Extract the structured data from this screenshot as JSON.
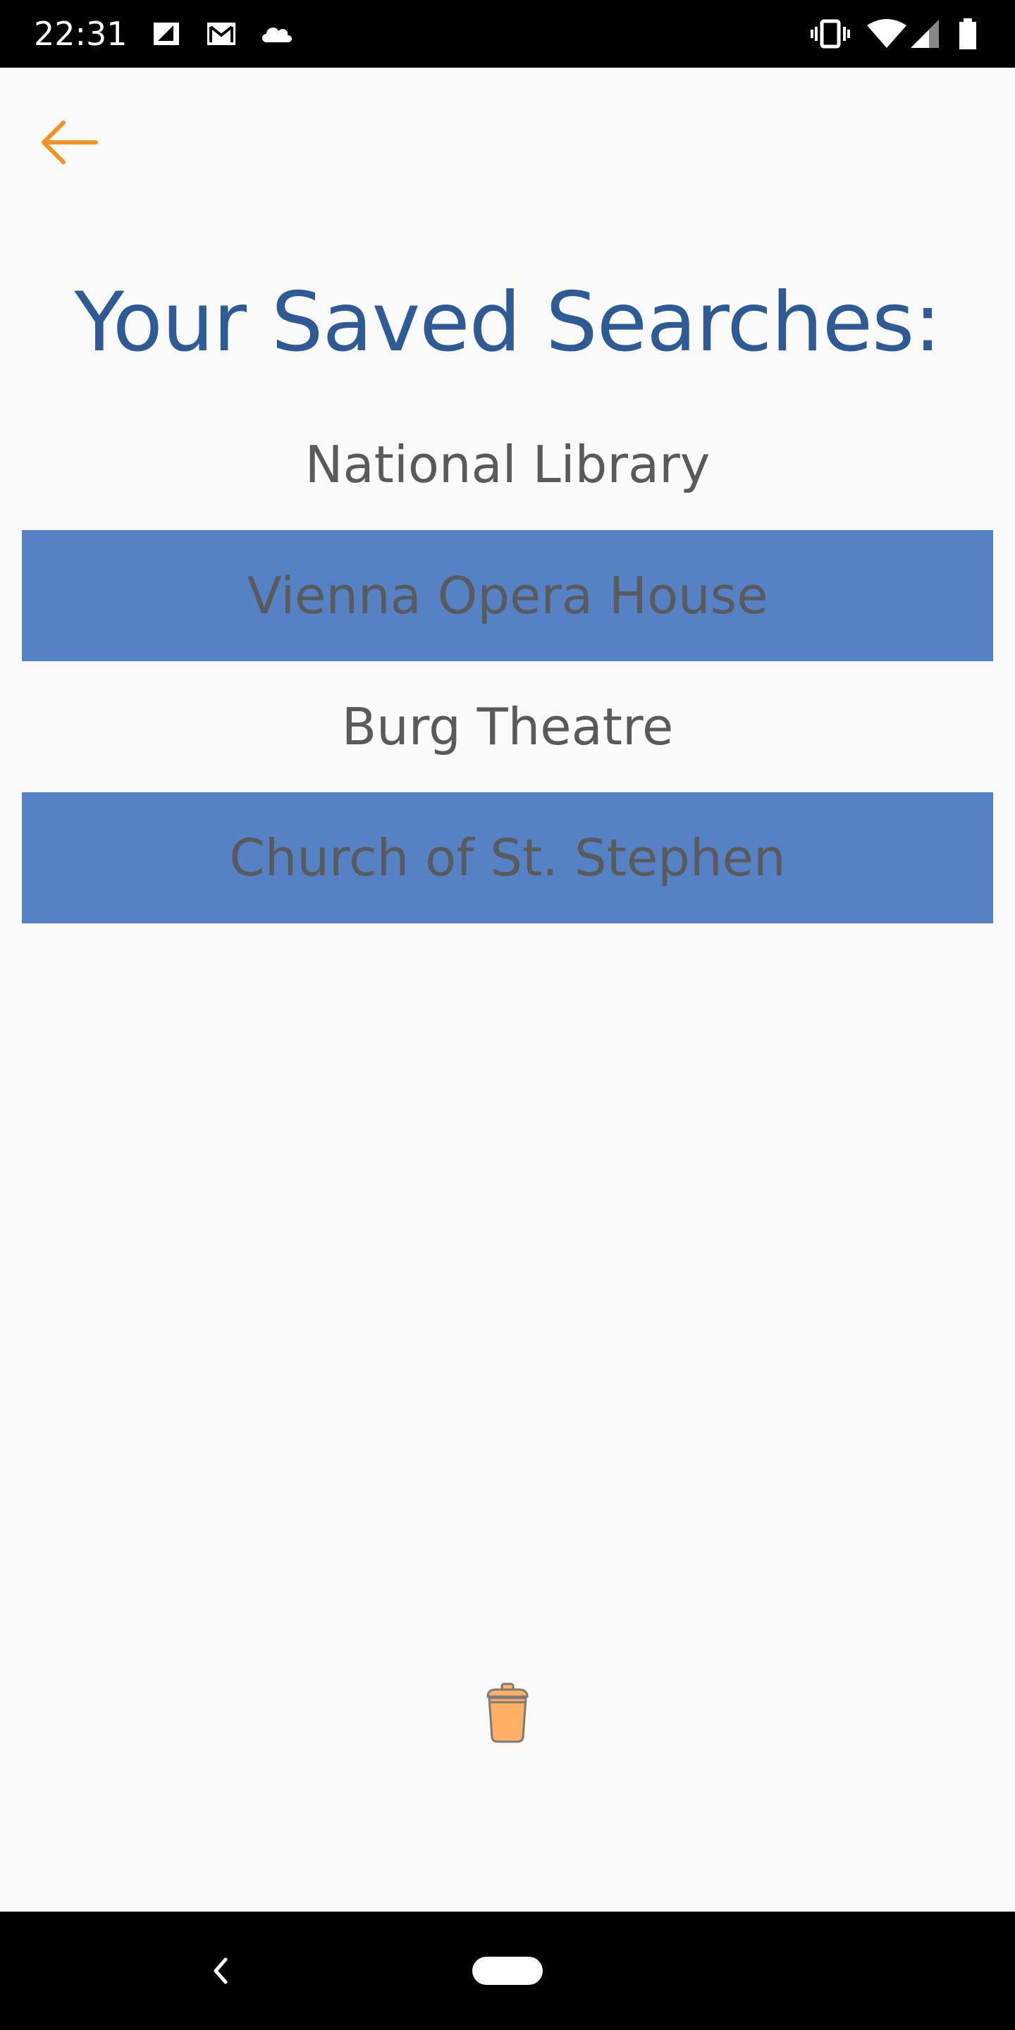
{
  "status_bar": {
    "time": "22:31",
    "left_icons": [
      "sim-card-icon",
      "gmail-icon",
      "cloud-icon"
    ],
    "right_icons": [
      "vibrate-icon",
      "wifi-icon",
      "cell-signal-icon",
      "battery-icon"
    ]
  },
  "app_bar": {
    "back_icon": "arrow-left-icon",
    "accent_color": "#f5921e"
  },
  "page": {
    "title": "Your Saved Searches:",
    "title_color": "#2e5a96"
  },
  "saved_searches": [
    {
      "label": "National Library",
      "highlighted": false
    },
    {
      "label": "Vienna Opera House",
      "highlighted": true
    },
    {
      "label": "Burg Theatre",
      "highlighted": false
    },
    {
      "label": "Church of St. Stephen",
      "highlighted": true
    }
  ],
  "colors": {
    "highlight": "#5582c4",
    "item_text": "#5a5a5a",
    "background": "#fafafa",
    "trash": "#ffb064"
  },
  "actions": {
    "delete_icon": "trash-can-icon"
  },
  "nav_bar": {
    "back_icon": "chevron-left-icon",
    "home_icon": "home-pill-icon"
  }
}
